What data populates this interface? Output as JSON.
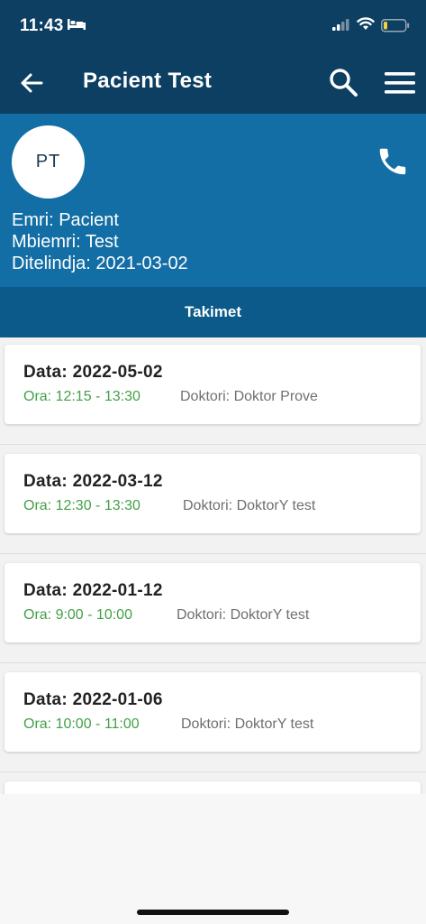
{
  "status_bar": {
    "time": "11:43",
    "icons": [
      "bed-icon",
      "signal-icon",
      "wifi-icon",
      "battery-icon"
    ]
  },
  "header": {
    "title": "Pacient Test",
    "icons": [
      "back-arrow-icon",
      "search-icon",
      "hamburger-menu-icon"
    ]
  },
  "profile": {
    "initials": "PT",
    "name_line": "Emri: Pacient",
    "surname_line": "Mbiemri: Test",
    "birthdate_line": "Ditelindja: 2021-03-02",
    "phone_icon": "phone-icon"
  },
  "tabs": [
    {
      "label": "Takimet"
    }
  ],
  "appointments": [
    {
      "date": "Data: 2022-05-02",
      "time": "Ora: 12:15 - 13:30",
      "doctor": "Doktori: Doktor Prove"
    },
    {
      "date": "Data: 2022-03-12",
      "time": "Ora: 12:30 - 13:30",
      "doctor": "Doktori: DoktorY test"
    },
    {
      "date": "Data: 2022-01-12",
      "time": "Ora: 9:00 - 10:00",
      "doctor": "Doktori: DoktorY test"
    },
    {
      "date": "Data: 2022-01-06",
      "time": "Ora: 10:00 - 11:00",
      "doctor": "Doktori: DoktorY test"
    }
  ],
  "colors": {
    "header_bg": "#0c3f62",
    "profile_bg": "#136ea5",
    "tab_bg": "#0b5a8a",
    "time_green": "#43a047",
    "doctor_gray": "#6f6f6f"
  }
}
